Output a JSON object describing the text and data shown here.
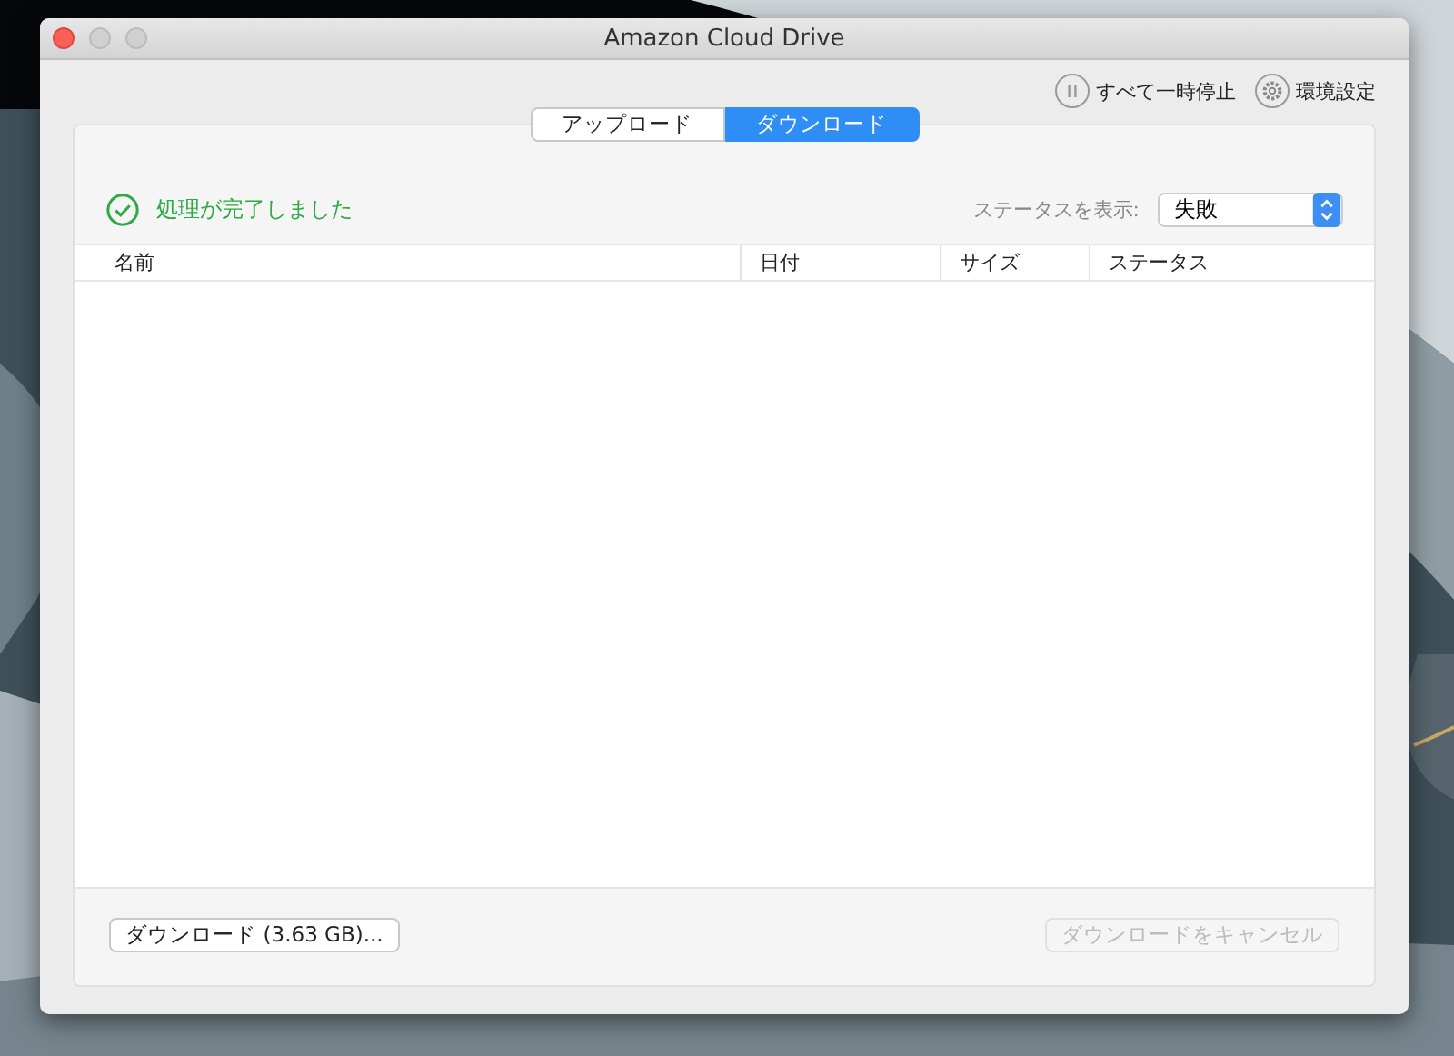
{
  "window": {
    "title": "Amazon Cloud Drive"
  },
  "toolbar": [
    {
      "kind": "pause",
      "label": "すべて一時停止"
    },
    {
      "kind": "settings",
      "label": "環境設定"
    }
  ],
  "tabs": [
    {
      "label": "アップロード",
      "selected": false
    },
    {
      "label": "ダウンロード",
      "selected": true
    }
  ],
  "status_message": "処理が完了しました",
  "filter": {
    "label": "ステータスを表示:",
    "value": "失敗"
  },
  "table": {
    "columns": [
      "名前",
      "日付",
      "サイズ",
      "ステータス"
    ]
  },
  "buttons": [
    {
      "label": "ダウンロード (3.63 GB)...",
      "disabled": false
    },
    {
      "label": "ダウンロードをキャンセル",
      "disabled": true
    }
  ]
}
